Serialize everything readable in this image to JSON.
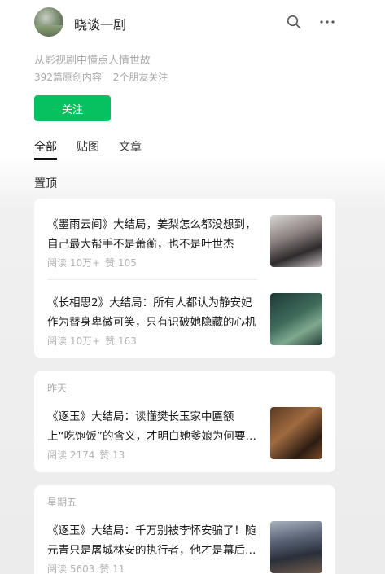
{
  "account": {
    "name": "晓谈一剧",
    "description": "从影视剧中懂点人情世故",
    "article_count": "392篇原创内容",
    "friends_following": "2个朋友关注",
    "follow_label": "关注"
  },
  "tabs": [
    {
      "label": "全部",
      "active": true
    },
    {
      "label": "贴图",
      "active": false
    },
    {
      "label": "文章",
      "active": false
    }
  ],
  "pinned_label": "置顶",
  "groups": [
    {
      "date": "",
      "articles": [
        {
          "title": "《墨雨云间》大结局，姜梨怎么都没想到，自己最大帮手不是萧蘅，也不是叶世杰",
          "reads": "阅读 10万+",
          "likes": "赞 105"
        },
        {
          "title": "《长相思2》大结局：所有人都认为静安妃作为替身卑微可笑，只有识破她隐藏的心机",
          "reads": "阅读 10万+",
          "likes": "赞 163"
        }
      ]
    },
    {
      "date": "昨天",
      "articles": [
        {
          "title": "《逐玉》大结局：读懂樊长玉家中匾额上“吃饱饭”的含义，才明白她爹娘为何要隐姓埋名",
          "reads": "阅读 2174",
          "likes": "赞 13"
        }
      ]
    },
    {
      "date": "星期五",
      "articles": [
        {
          "title": "《逐玉》大结局：千万别被李怀安骗了！随元青只是屠城林安的执行者，他才是幕后主使",
          "reads": "阅读 5603",
          "likes": "赞 11"
        }
      ]
    }
  ],
  "icons": {
    "search": "search-icon",
    "more": "more-icon"
  },
  "colors": {
    "accent": "#07c160",
    "muted": "#a9a9a9"
  }
}
